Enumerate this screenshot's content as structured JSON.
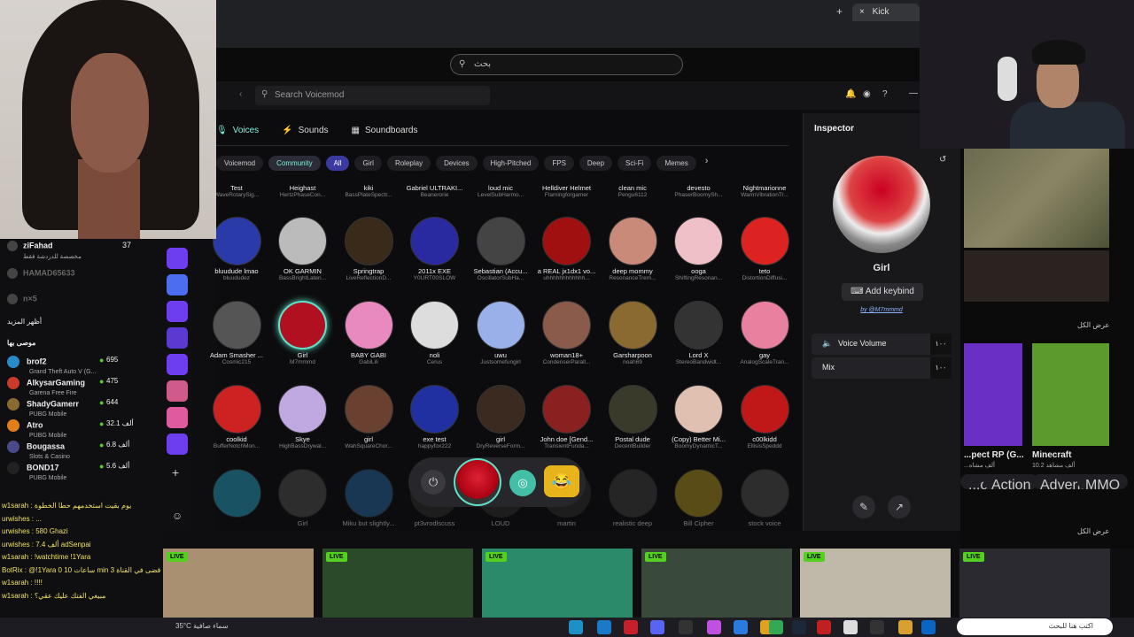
{
  "browser": {
    "tab_title": "Kick",
    "tab_close": "×",
    "new_tab": "+"
  },
  "kick": {
    "search_placeholder": "بحث",
    "view_all": "عرض الكل",
    "view_all_2": "عرض الكل"
  },
  "voicemod": {
    "search_placeholder": "Search Voicemod",
    "tabs": [
      "Voices",
      "Sounds",
      "Soundboards"
    ],
    "filters": [
      "Voicemod",
      "Community",
      "All",
      "Girl",
      "Roleplay",
      "Devices",
      "High-Pitched",
      "FPS",
      "Deep",
      "Sci-Fi",
      "Memes"
    ],
    "voices_top": [
      {
        "name": "Test",
        "sub": "WaveRotarySig..."
      },
      {
        "name": "Heighast",
        "sub": "HertzPhaseCon..."
      },
      {
        "name": "kiki",
        "sub": "BassPlateSpectr..."
      },
      {
        "name": "Gabriel ULTRAKI...",
        "sub": "Beanerorie"
      },
      {
        "name": "loud mic",
        "sub": "LevelSubHarmo..."
      },
      {
        "name": "Helldiver Helmet",
        "sub": "Flamingforgamer"
      },
      {
        "name": "clean mic",
        "sub": "Pengu6112"
      },
      {
        "name": "devesto",
        "sub": "PhaserBoomySh..."
      },
      {
        "name": "Nightmarionne",
        "sub": "WarmVibrationTr..."
      }
    ],
    "voices_row1": [
      {
        "name": "bluudude lmao",
        "sub": "bluududez",
        "color": "#2a3aa8"
      },
      {
        "name": "OK GARMIN",
        "sub": "BassBrightLaten...",
        "color": "#bbb"
      },
      {
        "name": "Springtrap",
        "sub": "LiveReflectionD...",
        "color": "#3a2a1a"
      },
      {
        "name": "2011x EXE",
        "sub": "Y0URT00SLOW",
        "color": "#2a2aa0"
      },
      {
        "name": "Sebastian (Accu...",
        "sub": "OscillatorSubHa...",
        "color": "#444"
      },
      {
        "name": "a REAL jx1dx1 vo...",
        "sub": "uhhhhhhhhhhhh...",
        "color": "#a01010"
      },
      {
        "name": "deep mommy",
        "sub": "ResonanceTrem...",
        "color": "#c98a7a"
      },
      {
        "name": "ooga",
        "sub": "ShiftingResonan...",
        "color": "#f0c0c8"
      },
      {
        "name": "teto",
        "sub": "DistortionDiffusi...",
        "color": "#d22"
      }
    ],
    "voices_row2": [
      {
        "name": "Adam Smasher ...",
        "sub": "Cosmic215",
        "color": "#555"
      },
      {
        "name": "Girl",
        "sub": "M7mmmd",
        "color": "#b01020"
      },
      {
        "name": "BABY GABI",
        "sub": "GabiLili",
        "color": "#e88ac0"
      },
      {
        "name": "noli",
        "sub": "Cerus",
        "color": "#ddd"
      },
      {
        "name": "uwu",
        "sub": "Justsomefungirl",
        "color": "#9ab0e8"
      },
      {
        "name": "woman18+",
        "sub": "CondenserParall...",
        "color": "#8a5a4a"
      },
      {
        "name": "Garsharpoon",
        "sub": "noah69",
        "color": "#8a6a30"
      },
      {
        "name": "Lord X",
        "sub": "StereoBandwidt...",
        "color": "#333"
      },
      {
        "name": "gay",
        "sub": "AnalogScaleTran...",
        "color": "#e880a0"
      }
    ],
    "voices_row3": [
      {
        "name": "coolkid",
        "sub": "BufferNotchMon...",
        "color": "#c22"
      },
      {
        "name": "Skye",
        "sub": "HighBassDrywal...",
        "color": "#c0a8e0"
      },
      {
        "name": "girl",
        "sub": "WahSquareChor...",
        "color": "#6a4030"
      },
      {
        "name": "exe test",
        "sub": "happyfox222",
        "color": "#2030a0"
      },
      {
        "name": "girl",
        "sub": "DryReverseForm...",
        "color": "#3a2a20"
      },
      {
        "name": "John doe [Gend...",
        "sub": "TransientFunda...",
        "color": "#8a2020"
      },
      {
        "name": "Postal dude",
        "sub": "DecentBuilder",
        "color": "#3a3a2a"
      },
      {
        "name": "(Copy) Better Mi...",
        "sub": "BoomyDynamicT...",
        "color": "#e0c0b0"
      },
      {
        "name": "c00lkidd",
        "sub": "EllisisSpeddd",
        "color": "#c01818"
      }
    ],
    "voices_row4": [
      {
        "name": "",
        "sub": "",
        "color": "#2aa8c8"
      },
      {
        "name": "Girl",
        "sub": "",
        "color": "#555"
      },
      {
        "name": "Miku but slightly...",
        "sub": "",
        "color": "#2a6aa8"
      },
      {
        "name": "pt3vrodlscuss",
        "sub": "",
        "color": "#333"
      },
      {
        "name": "LOUD",
        "sub": "",
        "color": "#333"
      },
      {
        "name": "martin",
        "sub": "",
        "color": "#333"
      },
      {
        "name": "realistic deep",
        "sub": "",
        "color": "#444"
      },
      {
        "name": "Bill Cipher",
        "sub": "",
        "color": "#b89a20"
      },
      {
        "name": "stock voice",
        "sub": "",
        "color": "#555"
      }
    ],
    "inspector": {
      "title": "Inspector",
      "name": "Girl",
      "keybind": "Add keybind",
      "by": "by @M7mmmd",
      "volume_label": "Voice Volume",
      "volume_value": "١٠٠",
      "mix_label": "Mix",
      "mix_value": "١٠٠"
    }
  },
  "chat": {
    "top_users": [
      {
        "name": "ziFahad",
        "sub": "مخصصة للدردشة فقط",
        "count": "37"
      },
      {
        "name": "HAMAD65633",
        "sub": "",
        "count": ""
      },
      {
        "name": "n×5",
        "sub": "",
        "count": ""
      }
    ],
    "show_more": "أظهر المزيد",
    "recommended": "موصى بها",
    "channels": [
      {
        "name": "brof2",
        "game": "Grand Theft Auto V (G...",
        "count": "695",
        "color": "#2a8ac8"
      },
      {
        "name": "AlkysarGaming",
        "game": "Garena Free Fire",
        "count": "475",
        "color": "#c83a2a"
      },
      {
        "name": "ShadyGamerr",
        "game": "PUBG Mobile",
        "count": "644",
        "color": "#8a6a30"
      },
      {
        "name": "Atro",
        "game": "PUBG Mobile",
        "count": "32.1 ألف",
        "color": "#e0801a"
      },
      {
        "name": "Bougassa",
        "game": "Slots & Casino",
        "count": "6.8 ألف",
        "color": "#4a4a8a"
      },
      {
        "name": "BOND17",
        "game": "PUBG Mobile",
        "count": "5.6 ألف",
        "color": "#222"
      }
    ],
    "ticker": [
      "w1sarah : يوم بقيت استخدمهم حطا الخطوة",
      "urwishes : ...",
      "urwishes : 580 Ghazi",
      "urwishes : 7.4 ألف adSenpai",
      "w1sarah : !watchtime !1Yara",
      "BotRix : @!1Yara 0 ساعات 10 min 3 أيام قضى في القناة",
      "w1sarah : !!!!",
      "w1sarah : مبيغي الفتك عليك عقي؟"
    ]
  },
  "kick_right": {
    "categories": [
      {
        "title": "...pect RP (G...",
        "sub": "...ألف مشاه",
        "tags": [
          "...oter",
          "Action"
        ]
      },
      {
        "title": "Minecraft",
        "sub": "10.2 ألف مشاهد",
        "tags": [
          "Adventure",
          "MMO"
        ]
      }
    ]
  },
  "live": {
    "badge": "LIVE"
  },
  "taskbar": {
    "weather": "35°C سماء صافية",
    "search": "اكتب هنا للبحث"
  }
}
